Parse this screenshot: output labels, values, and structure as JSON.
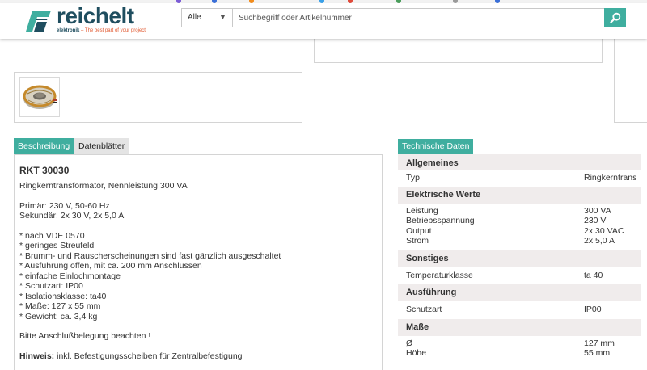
{
  "header": {
    "logo_word": "reichelt",
    "logo_sub_brand": "elektronik",
    "logo_sub_tagline": "– The best part of your project",
    "search_category": "Alle",
    "search_placeholder": "Suchbegriff oder Artikelnummer"
  },
  "tabs": {
    "description": "Beschreibung",
    "datasheets": "Datenblätter",
    "technical": "Technische Daten"
  },
  "description": {
    "title": "RKT 30030",
    "subtitle": "Ringkerntransformator, Nennleistung 300 VA",
    "primary": "Primär: 230 V, 50-60 Hz",
    "secondary": "Sekundär: 2x 30 V, 2x 5,0 A",
    "features": [
      "* nach VDE 0570",
      "* geringes Streufeld",
      "* Brumm- und Rauscherscheinungen sind fast gänzlich ausgeschaltet",
      "* Ausführung offen, mit ca. 200 mm Anschlüssen",
      "* einfache Einlochmontage",
      "* Schutzart: IP00",
      "* Isolationsklasse: ta40",
      "* Maße: 127 x 55 mm",
      "* Gewicht: ca. 3,4 kg"
    ],
    "note": "Bitte Anschlußbelegung beachten !",
    "hint_label": "Hinweis:",
    "hint_text": " inkl. Befestigungsscheiben für Zentralbefestigung"
  },
  "technical": {
    "sections": [
      {
        "title": "Allgemeines",
        "rows": [
          {
            "key": "Typ",
            "value": "Ringkerntrans"
          }
        ]
      },
      {
        "title": "Elektrische Werte",
        "rows": [
          {
            "key": "Leistung",
            "value": "300 VA"
          },
          {
            "key": "Betriebsspannung",
            "value": "230 V"
          },
          {
            "key": "Output",
            "value": "2x 30 VAC"
          },
          {
            "key": "Strom",
            "value": "2x 5,0 A"
          }
        ]
      },
      {
        "title": "Sonstiges",
        "rows": [
          {
            "key": "Temperaturklasse",
            "value": "ta 40"
          }
        ]
      },
      {
        "title": "Ausführung",
        "rows": [
          {
            "key": "Schutzart",
            "value": "IP00"
          }
        ]
      },
      {
        "title": "Maße",
        "rows": [
          {
            "key": "Ø",
            "value": "127 mm"
          },
          {
            "key": "Höhe",
            "value": "55 mm"
          }
        ]
      }
    ]
  },
  "colors": {
    "accent": "#3fae9f",
    "brand": "#1f4e5f",
    "section_bg": "#f0ecec",
    "border": "#d4d4d4"
  },
  "icons": {
    "logo": "reichelt-logo-icon",
    "search": "search-icon",
    "dropdown": "dropdown-arrow-icon",
    "product": "toroidal-transformer-image"
  }
}
